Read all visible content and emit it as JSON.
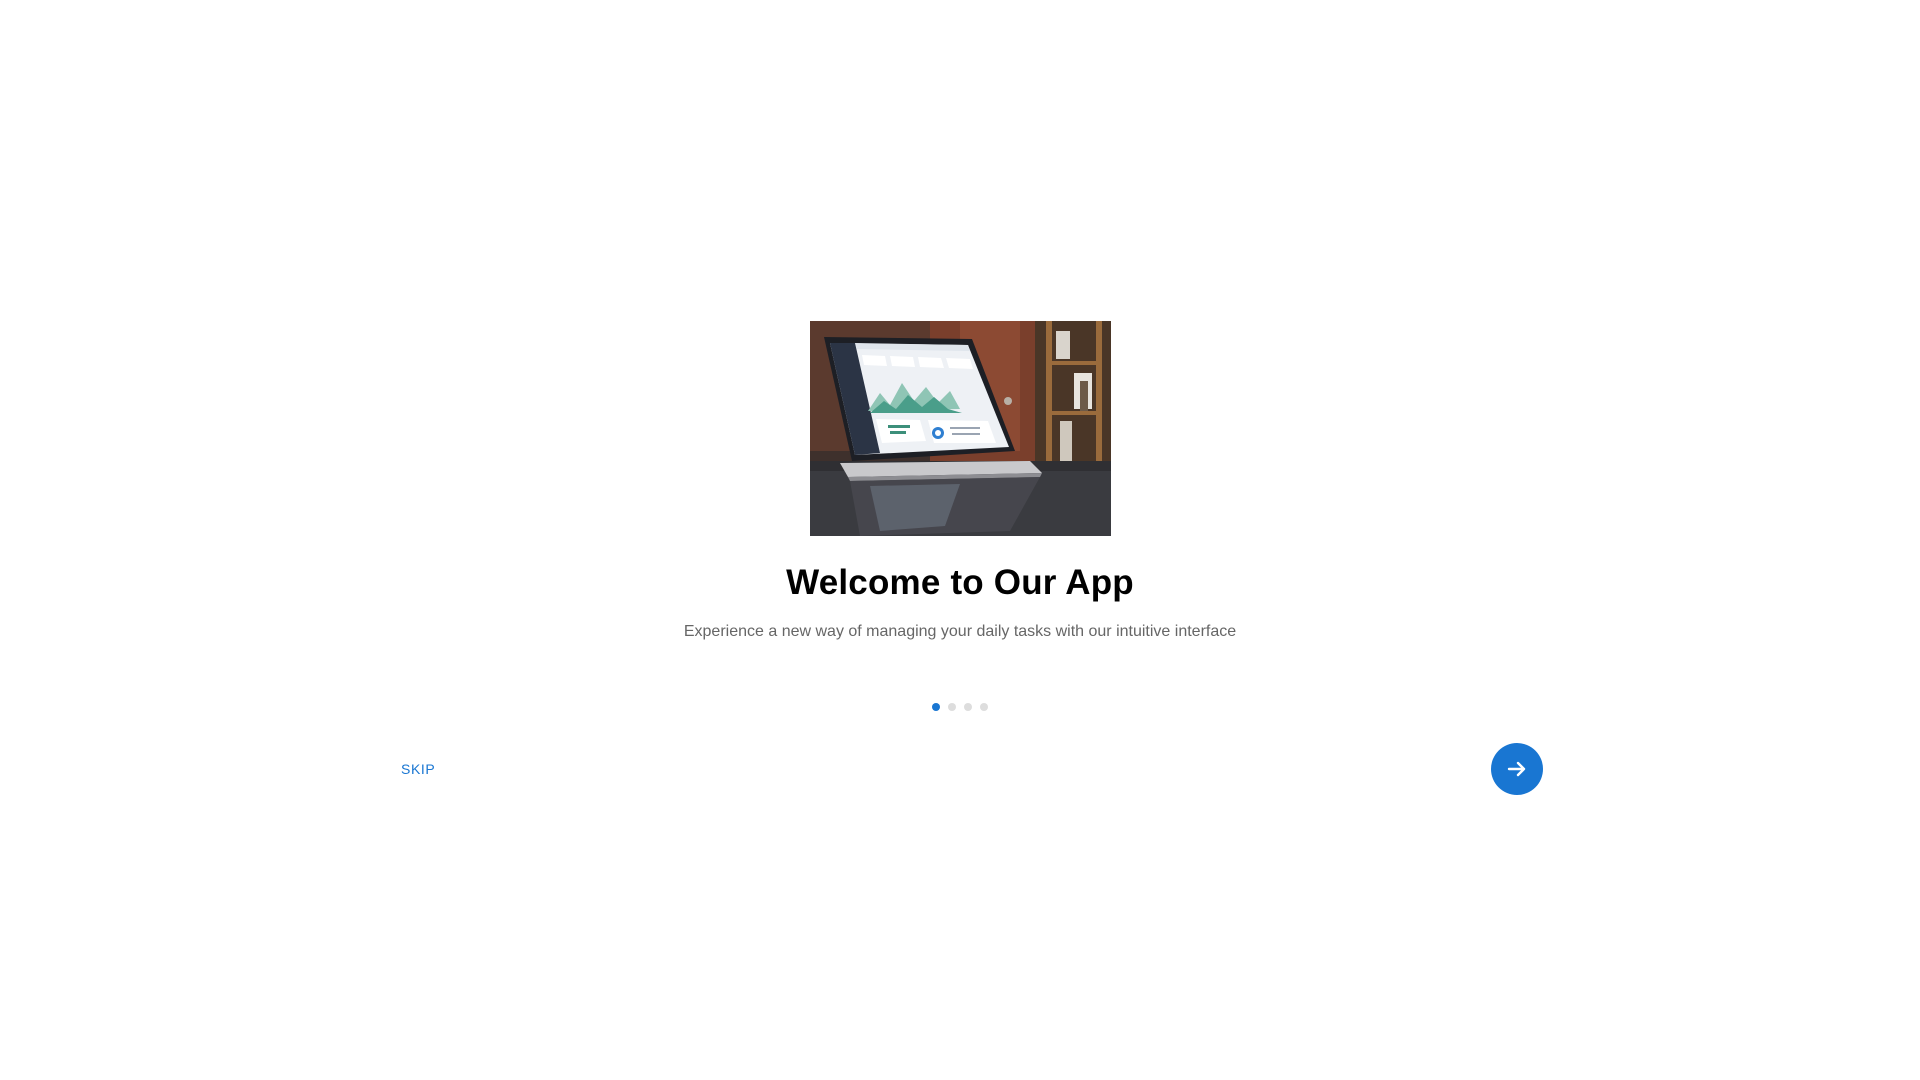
{
  "slide": {
    "image_alt": "Laptop displaying analytics dashboard",
    "title": "Welcome to Our App",
    "subtitle": "Experience a new way of managing your daily tasks with our intuitive interface"
  },
  "pagination": {
    "total": 4,
    "active_index": 0
  },
  "actions": {
    "skip_label": "SKIP",
    "next_icon": "arrow-right-icon"
  },
  "colors": {
    "accent": "#1976d2",
    "title": "#000000",
    "subtitle": "#666666",
    "dot_inactive": "#dddddd",
    "background": "#ffffff"
  }
}
